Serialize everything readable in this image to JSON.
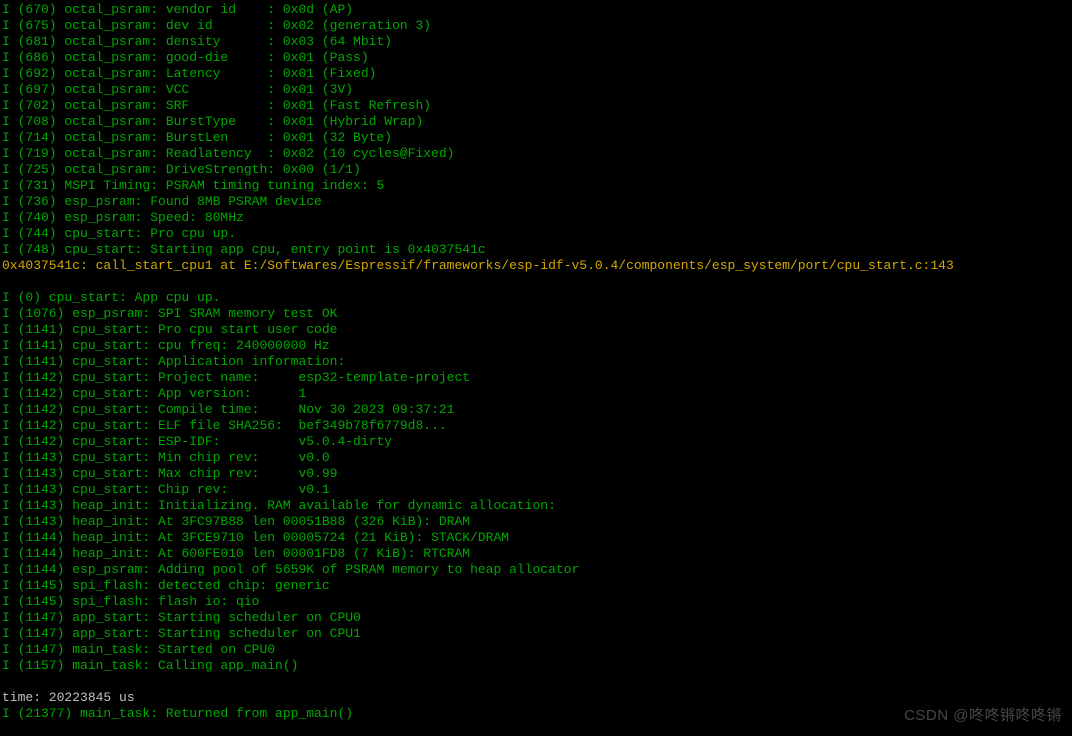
{
  "lines": [
    {
      "color": "green",
      "text": "I (670) octal_psram: vendor id    : 0x0d (AP)"
    },
    {
      "color": "green",
      "text": "I (675) octal_psram: dev id       : 0x02 (generation 3)"
    },
    {
      "color": "green",
      "text": "I (681) octal_psram: density      : 0x03 (64 Mbit)"
    },
    {
      "color": "green",
      "text": "I (686) octal_psram: good-die     : 0x01 (Pass)"
    },
    {
      "color": "green",
      "text": "I (692) octal_psram: Latency      : 0x01 (Fixed)"
    },
    {
      "color": "green",
      "text": "I (697) octal_psram: VCC          : 0x01 (3V)"
    },
    {
      "color": "green",
      "text": "I (702) octal_psram: SRF          : 0x01 (Fast Refresh)"
    },
    {
      "color": "green",
      "text": "I (708) octal_psram: BurstType    : 0x01 (Hybrid Wrap)"
    },
    {
      "color": "green",
      "text": "I (714) octal_psram: BurstLen     : 0x01 (32 Byte)"
    },
    {
      "color": "green",
      "text": "I (719) octal_psram: Readlatency  : 0x02 (10 cycles@Fixed)"
    },
    {
      "color": "green",
      "text": "I (725) octal_psram: DriveStrength: 0x00 (1/1)"
    },
    {
      "color": "green",
      "text": "I (731) MSPI Timing: PSRAM timing tuning index: 5"
    },
    {
      "color": "green",
      "text": "I (736) esp_psram: Found 8MB PSRAM device"
    },
    {
      "color": "green",
      "text": "I (740) esp_psram: Speed: 80MHz"
    },
    {
      "color": "green",
      "text": "I (744) cpu_start: Pro cpu up."
    },
    {
      "color": "green",
      "text": "I (748) cpu_start: Starting app cpu, entry point is 0x4037541c"
    },
    {
      "color": "yellow",
      "text": "0x4037541c: call_start_cpu1 at E:/Softwares/Espressif/frameworks/esp-idf-v5.0.4/components/esp_system/port/cpu_start.c:143"
    },
    {
      "color": "green",
      "text": ""
    },
    {
      "color": "green",
      "text": "I (0) cpu_start: App cpu up."
    },
    {
      "color": "green",
      "text": "I (1076) esp_psram: SPI SRAM memory test OK"
    },
    {
      "color": "green",
      "text": "I (1141) cpu_start: Pro cpu start user code"
    },
    {
      "color": "green",
      "text": "I (1141) cpu_start: cpu freq: 240000000 Hz"
    },
    {
      "color": "green",
      "text": "I (1141) cpu_start: Application information:"
    },
    {
      "color": "green",
      "text": "I (1142) cpu_start: Project name:     esp32-template-project"
    },
    {
      "color": "green",
      "text": "I (1142) cpu_start: App version:      1"
    },
    {
      "color": "green",
      "text": "I (1142) cpu_start: Compile time:     Nov 30 2023 09:37:21"
    },
    {
      "color": "green",
      "text": "I (1142) cpu_start: ELF file SHA256:  bef349b78f6779d8..."
    },
    {
      "color": "green",
      "text": "I (1142) cpu_start: ESP-IDF:          v5.0.4-dirty"
    },
    {
      "color": "green",
      "text": "I (1143) cpu_start: Min chip rev:     v0.0"
    },
    {
      "color": "green",
      "text": "I (1143) cpu_start: Max chip rev:     v0.99"
    },
    {
      "color": "green",
      "text": "I (1143) cpu_start: Chip rev:         v0.1"
    },
    {
      "color": "green",
      "text": "I (1143) heap_init: Initializing. RAM available for dynamic allocation:"
    },
    {
      "color": "green",
      "text": "I (1143) heap_init: At 3FC97B88 len 00051B88 (326 KiB): DRAM"
    },
    {
      "color": "green",
      "text": "I (1144) heap_init: At 3FCE9710 len 00005724 (21 KiB): STACK/DRAM"
    },
    {
      "color": "green",
      "text": "I (1144) heap_init: At 600FE010 len 00001FD8 (7 KiB): RTCRAM"
    },
    {
      "color": "green",
      "text": "I (1144) esp_psram: Adding pool of 5659K of PSRAM memory to heap allocator"
    },
    {
      "color": "green",
      "text": "I (1145) spi_flash: detected chip: generic"
    },
    {
      "color": "green",
      "text": "I (1145) spi_flash: flash io: qio"
    },
    {
      "color": "green",
      "text": "I (1147) app_start: Starting scheduler on CPU0"
    },
    {
      "color": "green",
      "text": "I (1147) app_start: Starting scheduler on CPU1"
    },
    {
      "color": "green",
      "text": "I (1147) main_task: Started on CPU0"
    },
    {
      "color": "green",
      "text": "I (1157) main_task: Calling app_main()"
    },
    {
      "color": "green",
      "text": ""
    },
    {
      "color": "white",
      "text": "time: 20223845 us"
    },
    {
      "color": "green",
      "text": "I (21377) main_task: Returned from app_main()"
    }
  ],
  "watermark": "CSDN @咚咚锵咚咚锵"
}
